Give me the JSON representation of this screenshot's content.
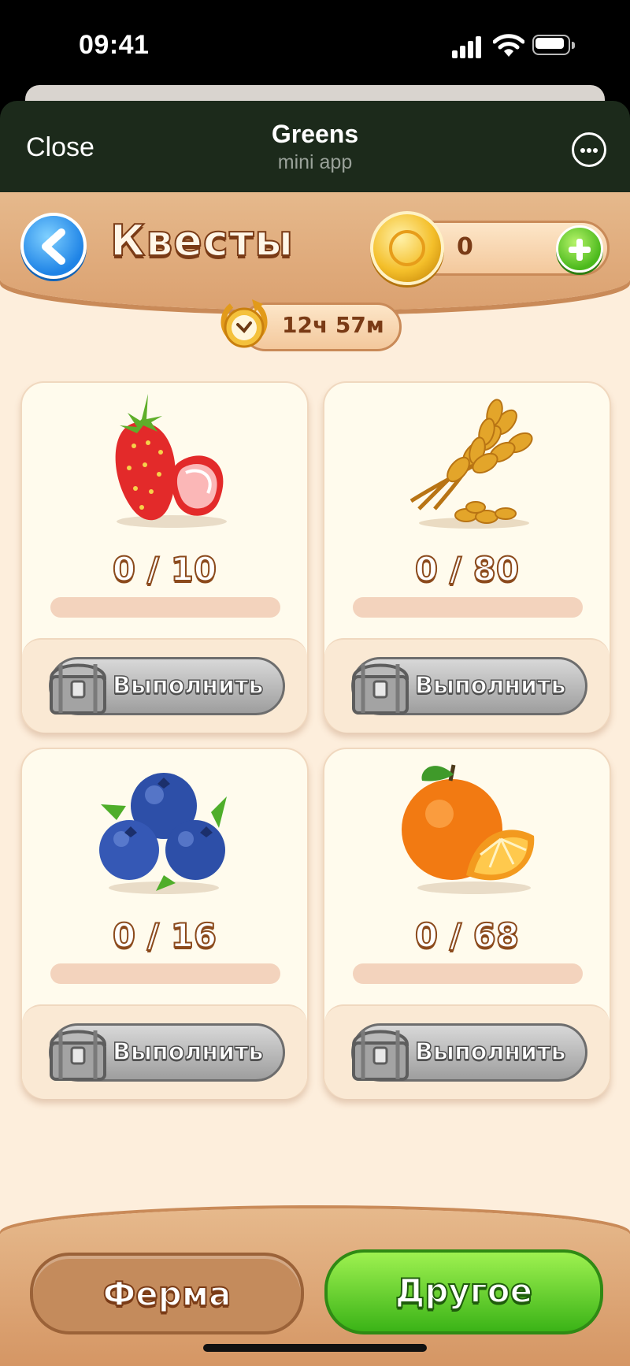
{
  "status_bar": {
    "time": "09:41"
  },
  "app_header": {
    "close_label": "Close",
    "title": "Greens",
    "subtitle": "mini app"
  },
  "game_header": {
    "title": "Квесты",
    "coins": "0",
    "timer": "12ч 57м"
  },
  "quests": [
    {
      "item": "strawberry",
      "progress_text": "0 / 10",
      "current": 0,
      "target": 10,
      "button_label": "Выполнить"
    },
    {
      "item": "wheat",
      "progress_text": "0 / 80",
      "current": 0,
      "target": 80,
      "button_label": "Выполнить"
    },
    {
      "item": "blueberry",
      "progress_text": "0 / 16",
      "current": 0,
      "target": 16,
      "button_label": "Выполнить"
    },
    {
      "item": "orange",
      "progress_text": "0 / 68",
      "current": 0,
      "target": 68,
      "button_label": "Выполнить"
    }
  ],
  "bottom_nav": {
    "farm_label": "Ферма",
    "other_label": "Другое",
    "active": "other"
  },
  "icons": {
    "back": "chevron-left-icon",
    "coin": "coin-icon",
    "add": "plus-icon",
    "timer": "clock-icon",
    "chest": "chest-icon",
    "more": "more-icon",
    "signal": "signal-icon",
    "wifi": "wifi-icon",
    "battery": "battery-icon"
  },
  "colors": {
    "header_bg": "#1c2a1b",
    "game_bg": "#fdeedc",
    "accent_green": "#4bb91c",
    "accent_blue": "#1e83e6",
    "brown": "#7a3b16"
  }
}
